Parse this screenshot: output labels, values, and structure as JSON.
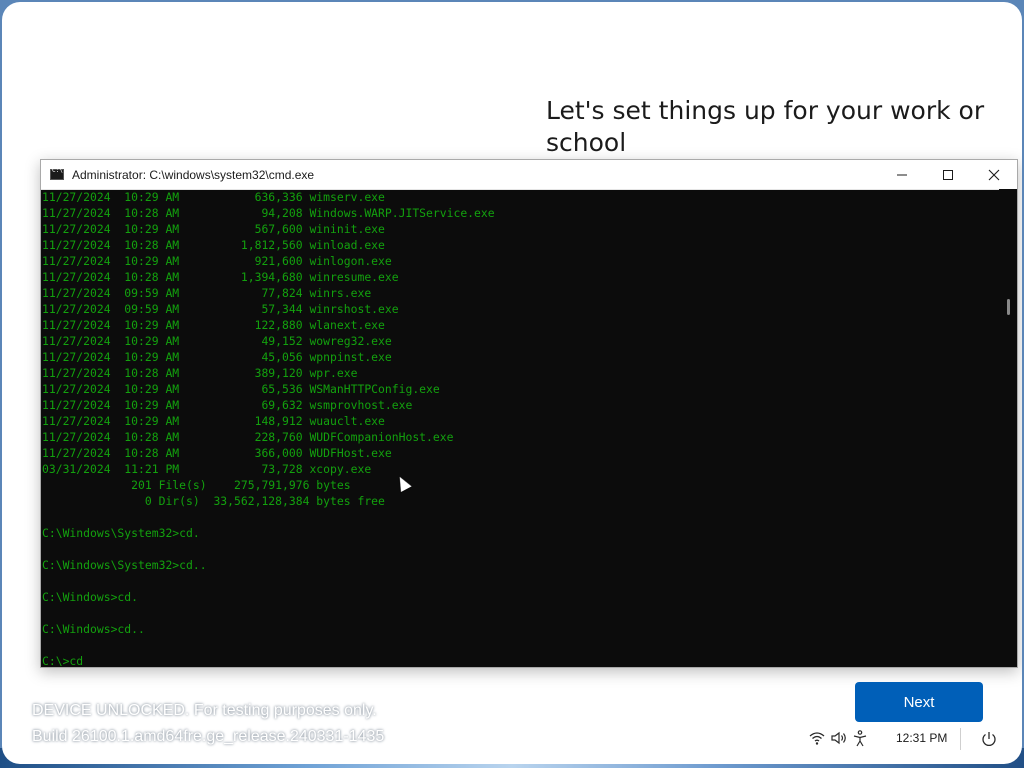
{
  "oobe": {
    "heading": "Let's set things up for your work or school",
    "next_label": "Next",
    "watermark_line1": "DEVICE UNLOCKED. For testing purposes only.",
    "watermark_line2": "Build 26100.1.amd64fre.ge_release.240331-1435",
    "clock": "12:31 PM"
  },
  "tray_icons": [
    "wifi-icon",
    "volume-icon",
    "accessibility-icon",
    "power-icon"
  ],
  "cmd": {
    "title": "Administrator: C:\\windows\\system32\\cmd.exe",
    "text_color": "#13a10e",
    "background_color": "#0c0c0c",
    "lines": [
      "11/27/2024  10:29 AM           636,336 wimserv.exe",
      "11/27/2024  10:28 AM            94,208 Windows.WARP.JITService.exe",
      "11/27/2024  10:29 AM           567,600 wininit.exe",
      "11/27/2024  10:28 AM         1,812,560 winload.exe",
      "11/27/2024  10:29 AM           921,600 winlogon.exe",
      "11/27/2024  10:28 AM         1,394,680 winresume.exe",
      "11/27/2024  09:59 AM            77,824 winrs.exe",
      "11/27/2024  09:59 AM            57,344 winrshost.exe",
      "11/27/2024  10:29 AM           122,880 wlanext.exe",
      "11/27/2024  10:29 AM            49,152 wowreg32.exe",
      "11/27/2024  10:29 AM            45,056 wpnpinst.exe",
      "11/27/2024  10:28 AM           389,120 wpr.exe",
      "11/27/2024  10:29 AM            65,536 WSManHTTPConfig.exe",
      "11/27/2024  10:29 AM            69,632 wsmprovhost.exe",
      "11/27/2024  10:29 AM           148,912 wuauclt.exe",
      "11/27/2024  10:28 AM           228,760 WUDFCompanionHost.exe",
      "11/27/2024  10:28 AM           366,000 WUDFHost.exe",
      "03/31/2024  11:21 PM            73,728 xcopy.exe",
      "             201 File(s)    275,791,976 bytes",
      "               0 Dir(s)  33,562,128,384 bytes free",
      "",
      "C:\\Windows\\System32>cd.",
      "",
      "C:\\Windows\\System32>cd..",
      "",
      "C:\\Windows>cd.",
      "",
      "C:\\Windows>cd..",
      "",
      "C:\\>cd"
    ]
  }
}
